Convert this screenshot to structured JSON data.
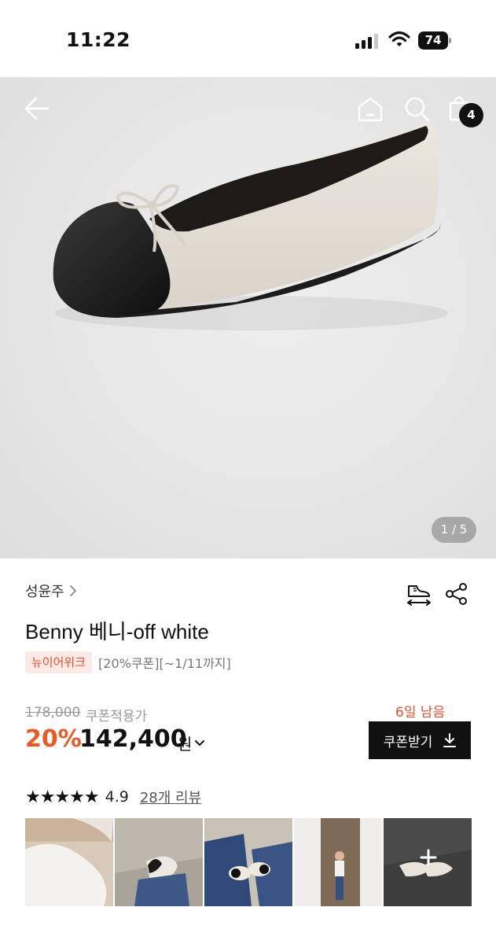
{
  "status_bar": {
    "time": "11:22",
    "battery": "74"
  },
  "hero": {
    "cart_count": "4",
    "page_indicator": "1 / 5"
  },
  "product": {
    "brand": "성윤주",
    "title": "Benny 베니-off white",
    "tag_badge": "뉴이어위크",
    "tag_text": "[20%쿠폰][~1/11까지]",
    "original_price": "178,000",
    "coupon_price_label": "쿠폰적용가",
    "discount": "20%",
    "price": "142,400",
    "currency": "원",
    "days_left": "6일 남음",
    "coupon_button": "쿠폰받기"
  },
  "reviews": {
    "rating": "4.9",
    "stars_filled": 5,
    "count_link": "28개 리뷰",
    "photo_count": 5
  },
  "colors": {
    "accent": "#e5512f",
    "discount": "#e85a26",
    "button_bg": "#111111"
  }
}
